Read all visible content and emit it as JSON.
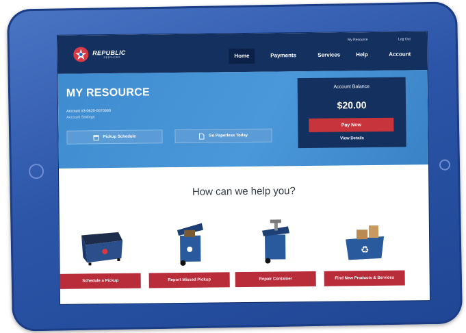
{
  "logo": {
    "name": "REPUBLIC",
    "sub": "SERVICES",
    "icon": "republic-star-logo"
  },
  "util_links": [
    "My Resource",
    "Log Out"
  ],
  "nav": [
    {
      "label": "Home",
      "active": true
    },
    {
      "label": "Payments",
      "active": false
    },
    {
      "label": "Services",
      "active": false
    },
    {
      "label": "Help",
      "active": false
    },
    {
      "label": "Account",
      "active": false
    }
  ],
  "hero": {
    "title": "MY RESOURCE",
    "account_number": "Account #3-0620-0070993",
    "account_settings": "Account Settings",
    "pickup_schedule": "Pickup Schedule",
    "go_paperless": "Go Paperless Today"
  },
  "balance": {
    "label": "Account Balance",
    "amount": "$20.00",
    "pay_now": "Pay Now",
    "view_details": "View Details"
  },
  "help": {
    "heading": "How can we help you?",
    "services": [
      {
        "label": "Schedule a Pickup",
        "icon": "dumpster-icon"
      },
      {
        "label": "Report Missed Pickup",
        "icon": "overflowing-cart-icon"
      },
      {
        "label": "Repair Container",
        "icon": "cart-repair-icon"
      },
      {
        "label": "Find New Products & Services",
        "icon": "recycling-bin-icon"
      }
    ]
  },
  "colors": {
    "navy": "#13305f",
    "hero_blue": "#4a98d9",
    "red": "#c8343c",
    "tablet_blue": "#2c55a8"
  }
}
